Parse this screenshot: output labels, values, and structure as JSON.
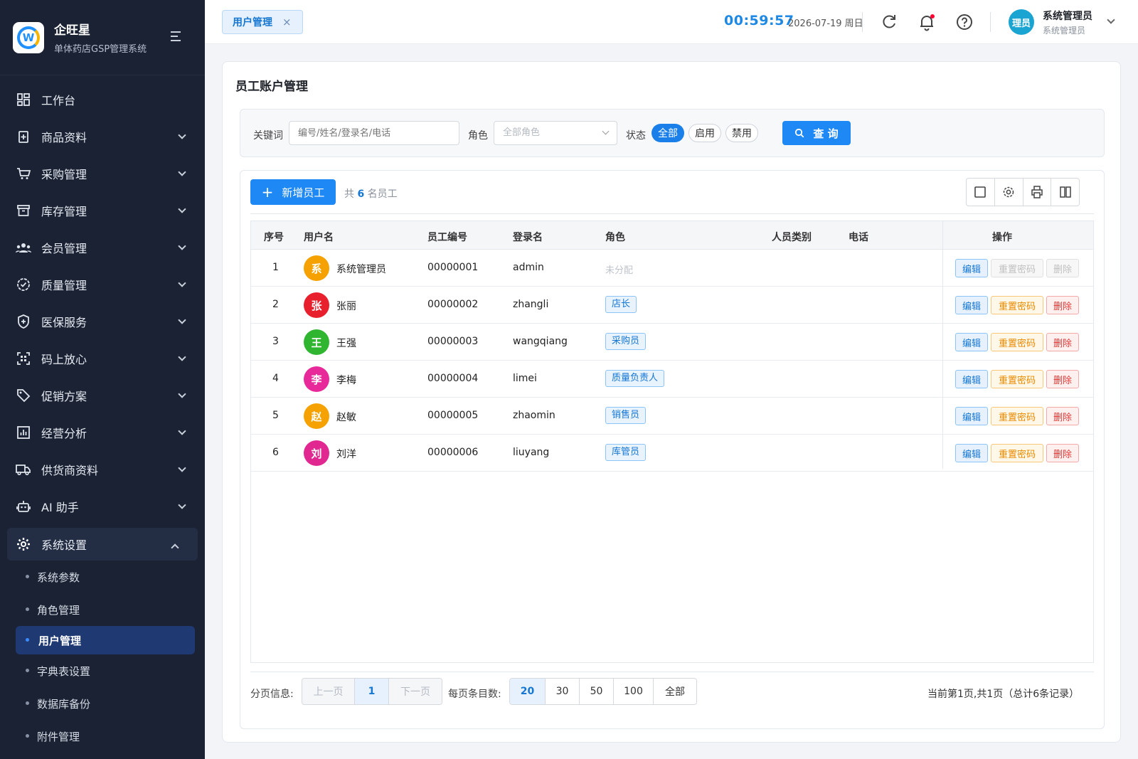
{
  "brand": {
    "name": "企旺星",
    "subtitle": "单体药店GSP管理系统"
  },
  "sidebar": {
    "items": [
      {
        "label": "工作台",
        "icon": "dashboard-icon"
      },
      {
        "label": "商品资料",
        "icon": "product-icon"
      },
      {
        "label": "采购管理",
        "icon": "cart-icon"
      },
      {
        "label": "库存管理",
        "icon": "archive-icon"
      },
      {
        "label": "会员管理",
        "icon": "users-icon"
      },
      {
        "label": "质量管理",
        "icon": "badge-check-icon"
      },
      {
        "label": "医保服务",
        "icon": "shield-plus-icon"
      },
      {
        "label": "码上放心",
        "icon": "qrcode-scan-icon"
      },
      {
        "label": "促销方案",
        "icon": "tag-icon"
      },
      {
        "label": "经营分析",
        "icon": "bar-chart-icon"
      },
      {
        "label": "供货商资料",
        "icon": "truck-icon"
      },
      {
        "label": "AI 助手",
        "icon": "robot-icon"
      },
      {
        "label": "系统设置",
        "icon": "gear-icon"
      }
    ],
    "sub_items": [
      "系统参数",
      "角色管理",
      "用户管理",
      "字典表设置",
      "数据库备份",
      "附件管理"
    ]
  },
  "topbar": {
    "tab_label": "用户管理",
    "tab_close": "×",
    "clock": "00:59:57",
    "date": "2026-07-19 周日",
    "avatar_text": "理员",
    "user_name": "系统管理员",
    "user_role": "系统管理员"
  },
  "page": {
    "title": "员工账户管理",
    "filter": {
      "keyword_label": "关键词",
      "keyword_placeholder": "编号/姓名/登录名/电话",
      "role_label": "角色",
      "role_value": "全部角色",
      "status_label": "状态",
      "status_options": [
        "全部",
        "启用",
        "禁用"
      ],
      "query_button": "查 询"
    },
    "add_button": "新增员工",
    "count_prefix": "共",
    "count_value": "6",
    "count_suffix": "名员工"
  },
  "table": {
    "columns": [
      "序号",
      "用户名",
      "员工编号",
      "登录名",
      "角色",
      "人员类别",
      "电话",
      "操作"
    ],
    "actions": {
      "edit": "编辑",
      "reset": "重置密码",
      "delete": "删除"
    },
    "rows": [
      {
        "no": "1",
        "avatar": "系",
        "avatar_color": "#f5a200",
        "name": "系统管理员",
        "code": "00000001",
        "login": "admin",
        "role": "未分配",
        "assigned": false
      },
      {
        "no": "2",
        "avatar": "张",
        "avatar_color": "#e8202d",
        "name": "张丽",
        "code": "00000002",
        "login": "zhangli",
        "role": "店长",
        "assigned": true
      },
      {
        "no": "3",
        "avatar": "王",
        "avatar_color": "#2fb52f",
        "name": "王强",
        "code": "00000003",
        "login": "wangqiang",
        "role": "采购员",
        "assigned": true
      },
      {
        "no": "4",
        "avatar": "李",
        "avatar_color": "#e8299a",
        "name": "李梅",
        "code": "00000004",
        "login": "limei",
        "role": "质量负责人",
        "assigned": true
      },
      {
        "no": "5",
        "avatar": "赵",
        "avatar_color": "#f5a200",
        "name": "赵敏",
        "code": "00000005",
        "login": "zhaomin",
        "role": "销售员",
        "assigned": true
      },
      {
        "no": "6",
        "avatar": "刘",
        "avatar_color": "#e02890",
        "name": "刘洋",
        "code": "00000006",
        "login": "liuyang",
        "role": "库管员",
        "assigned": true
      }
    ]
  },
  "pagination": {
    "label": "分页信息:",
    "prev": "上一页",
    "current": "1",
    "next": "下一页",
    "size_label": "每页条目数:",
    "sizes": [
      "20",
      "30",
      "50",
      "100",
      "全部"
    ],
    "selected_size": "20",
    "summary": "当前第1页,共1页（总计6条记录）"
  },
  "colors": {
    "primary": "#1e88f5",
    "sidebar_bg": "#1a2233",
    "warning": "#e88a00",
    "danger": "#e53935"
  }
}
